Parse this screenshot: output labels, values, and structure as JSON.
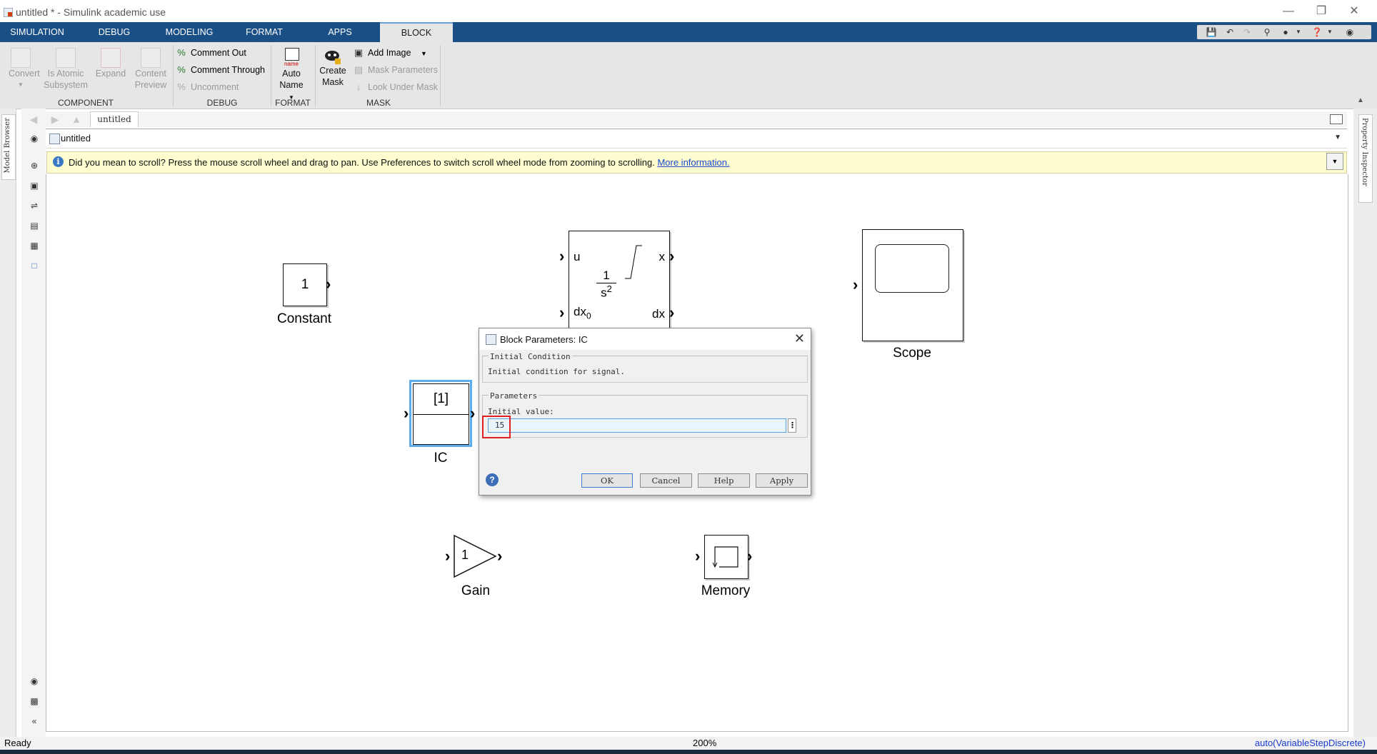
{
  "window": {
    "title": "untitled * - Simulink academic use",
    "controls": [
      "minimize",
      "restore",
      "close"
    ]
  },
  "tabs": [
    {
      "label": "SIMULATION",
      "active": false
    },
    {
      "label": "DEBUG",
      "active": false
    },
    {
      "label": "MODELING",
      "active": false
    },
    {
      "label": "FORMAT",
      "active": false
    },
    {
      "label": "APPS",
      "active": false
    },
    {
      "label": "BLOCK",
      "active": true
    }
  ],
  "ribbon": {
    "component": {
      "section_label": "COMPONENT",
      "convert": "Convert",
      "is_atomic_1": "Is Atomic",
      "is_atomic_2": "Subsystem",
      "expand": "Expand",
      "content_1": "Content",
      "content_2": "Preview"
    },
    "debug": {
      "section_label": "DEBUG",
      "comment_out": "Comment Out",
      "comment_through": "Comment Through",
      "uncomment": "Uncomment"
    },
    "format": {
      "section_label": "FORMAT",
      "icon_text": "name",
      "auto": "Auto",
      "name": "Name"
    },
    "mask": {
      "section_label": "MASK",
      "create_1": "Create",
      "create_2": "Mask",
      "add_image": "Add Image",
      "mask_parameters": "Mask Parameters",
      "look_under_mask": "Look Under Mask"
    }
  },
  "editor": {
    "breadcrumb_tab": "untitled",
    "address": "untitled",
    "left_panel_tab": "Model Browser",
    "right_panel_tab": "Property Inspector",
    "info_message": "Did you mean to scroll? Press the mouse scroll wheel and drag to pan. Use Preferences to switch scroll wheel mode from zooming to scrolling.",
    "info_link": "More information."
  },
  "blocks": {
    "constant": {
      "value": "1",
      "label": "Constant"
    },
    "integrator": {
      "u": "u",
      "x": "x",
      "dx0": "dx",
      "dx0_sub": "0",
      "dx": "dx",
      "num": "1",
      "den": "s",
      "den_exp": "2"
    },
    "scope": {
      "label": "Scope"
    },
    "ic": {
      "value": "[1]",
      "label": "IC"
    },
    "gain": {
      "value": "1",
      "label": "Gain"
    },
    "memory": {
      "label": "Memory"
    }
  },
  "dialog": {
    "title": "Block Parameters: IC",
    "group1_title": "Initial Condition",
    "description": "Initial condition for signal.",
    "group2_title": "Parameters",
    "param_label": "Initial value:",
    "param_value": "15",
    "ok": "OK",
    "cancel": "Cancel",
    "help": "Help",
    "apply": "Apply"
  },
  "status": {
    "left": "Ready",
    "zoom": "200%",
    "solver": "auto(VariableStepDiscrete)"
  },
  "colors": {
    "tabstrip": "#1a4f86",
    "selection": "#5aaef0",
    "highlight": "#e02020",
    "link": "#1a4ad0",
    "infobar": "#fefdd0"
  }
}
